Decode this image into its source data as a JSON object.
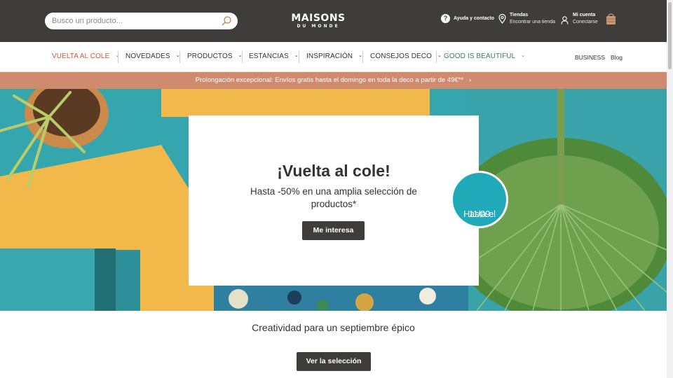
{
  "header": {
    "search_placeholder": "Busco un producto...",
    "logo_line1": "MAISONS",
    "logo_line2": "DU MONDE",
    "help_label": "Ayuda y contacto",
    "stores_title": "Tiendas",
    "stores_sub": "Encontrar una tienda",
    "account_title": "Mi cuenta",
    "account_sub": "Conectarse"
  },
  "nav": {
    "items": [
      {
        "label": "VUELTA AL COLE",
        "color": "#d0573f"
      },
      {
        "label": "NOVEDADES",
        "color": "#333333"
      },
      {
        "label": "PRODUCTOS",
        "color": "#333333"
      },
      {
        "label": "ESTANCIAS",
        "color": "#333333"
      },
      {
        "label": "INSPIRACIÓN",
        "color": "#333333"
      },
      {
        "label": "CONSEJOS DECO",
        "color": "#333333"
      },
      {
        "label": "GOOD IS BEAUTIFUL",
        "color": "#3e7d4e"
      }
    ],
    "business": "BUSINESS",
    "blog": "Blog"
  },
  "promo": {
    "text": "Prolongación excepcional: Envíos gratis hasta el domingo en toda la deco a partir de 49€**"
  },
  "hero": {
    "title": "¡Vuelta al cole!",
    "subtitle": "Hasta -50% en una amplia selección de productos*",
    "cta": "Me interesa",
    "badge_line1": "Hasta el",
    "badge_line2": "11/09"
  },
  "section": {
    "tagline": "Creatividad para un septiembre épico",
    "cta": "Ver la selección"
  },
  "colors": {
    "header_bg": "#3f3d3b",
    "promo_bg": "#d08a6d",
    "accent_red": "#d0573f",
    "accent_green": "#3e7d4e",
    "badge_teal": "#20a9b8"
  }
}
